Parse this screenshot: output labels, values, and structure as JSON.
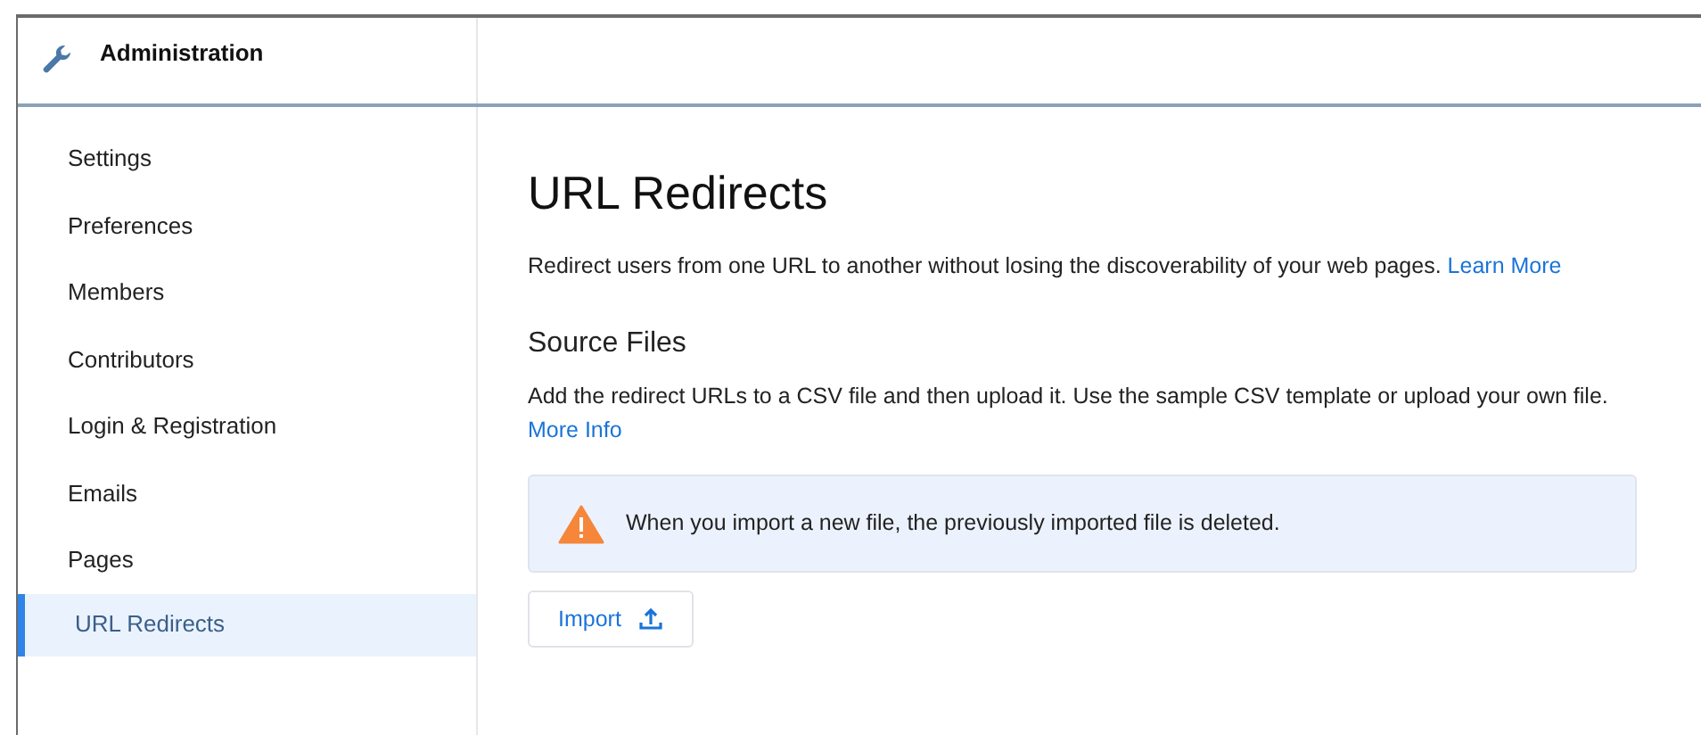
{
  "header": {
    "title": "Administration"
  },
  "sidebar": {
    "items": [
      {
        "label": "Settings",
        "selected": false
      },
      {
        "label": "Preferences",
        "selected": false
      },
      {
        "label": "Members",
        "selected": false
      },
      {
        "label": "Contributors",
        "selected": false
      },
      {
        "label": "Login & Registration",
        "selected": false
      },
      {
        "label": "Emails",
        "selected": false
      },
      {
        "label": "Pages",
        "selected": false
      },
      {
        "label": "URL Redirects",
        "selected": true
      }
    ]
  },
  "main": {
    "title": "URL Redirects",
    "description": "Redirect users from one URL to another without losing the discoverability of your web pages.",
    "description_link": "Learn More",
    "section_title": "Source Files",
    "section_text": "Add the redirect URLs to a CSV file and then upload it. Use the sample CSV template or upload your own file.",
    "section_link": "More Info",
    "alert": {
      "kind": "warning",
      "text": "When you import a new file, the previously imported file is deleted."
    },
    "import_button": "Import"
  }
}
